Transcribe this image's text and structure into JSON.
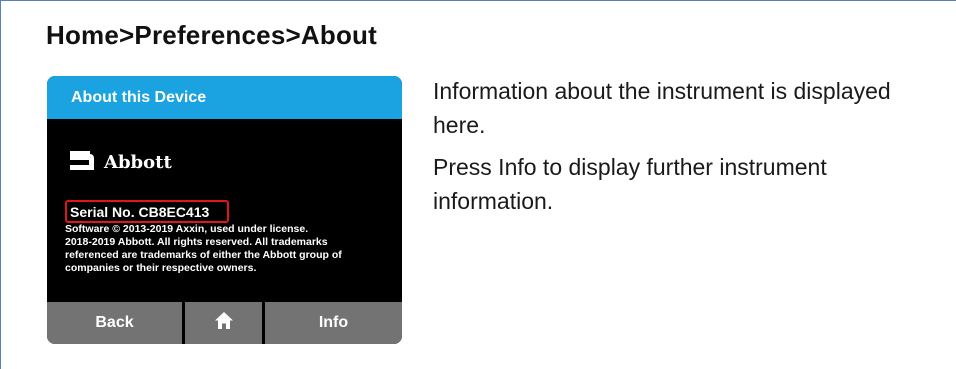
{
  "breadcrumb": "Home>Preferences>About",
  "device": {
    "header_title": "About this Device",
    "logo_text": "Abbott",
    "serial": "Serial No. CB8EC413",
    "legal_lines": [
      "Software © 2013-2019 Axxin, used under license.",
      "2018-2019 Abbott. All rights reserved. All trademarks",
      "referenced are trademarks of either the Abbott group of",
      "companies or their respective owners."
    ],
    "buttons": {
      "back": "Back",
      "home_icon": "home-icon",
      "info": "Info"
    },
    "colors": {
      "header": "#1aa3e0",
      "screen": "#000000",
      "button": "#737373",
      "highlight": "#e0161a"
    }
  },
  "description": {
    "line1": "Information about the instrument is displayed here.",
    "line2": "Press Info to display further instrument information."
  }
}
